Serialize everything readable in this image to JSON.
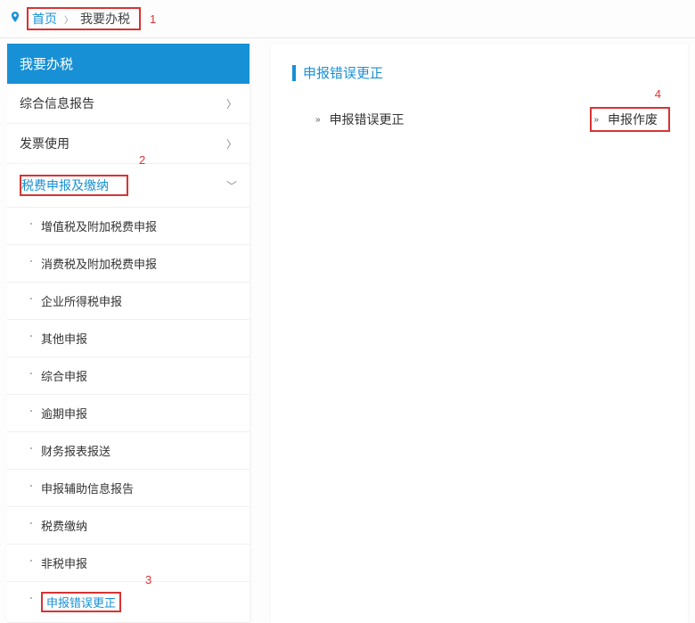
{
  "breadcrumb": {
    "home": "首页",
    "current": "我要办税"
  },
  "annotations": {
    "a1": "1",
    "a2": "2",
    "a3": "3",
    "a4": "4"
  },
  "sidebar": {
    "title": "我要办税",
    "items": {
      "i0": "综合信息报告",
      "i1": "发票使用",
      "i2": "税费申报及缴纳"
    },
    "sub": {
      "s0": "增值税及附加税费申报",
      "s1": "消费税及附加税费申报",
      "s2": "企业所得税申报",
      "s3": "其他申报",
      "s4": "综合申报",
      "s5": "逾期申报",
      "s6": "财务报表报送",
      "s7": "申报辅助信息报告",
      "s8": "税费缴纳",
      "s9": "非税申报",
      "s10": "申报错误更正"
    }
  },
  "content": {
    "title": "申报错误更正",
    "item1": "申报错误更正",
    "item2": "申报作废"
  }
}
